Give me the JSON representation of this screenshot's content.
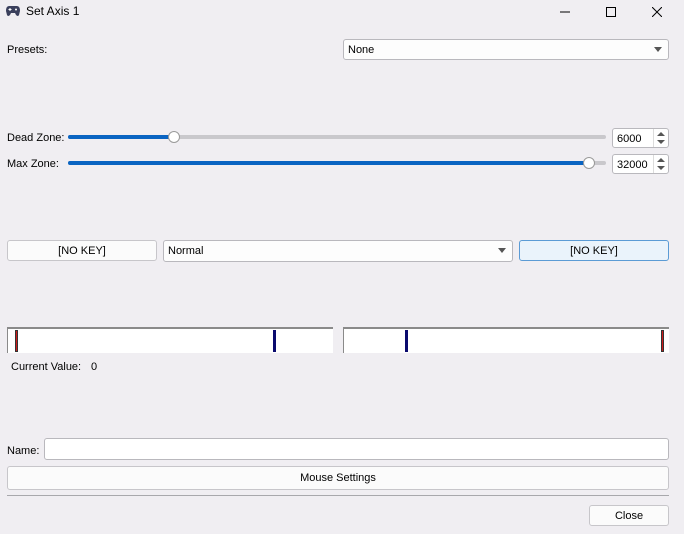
{
  "window": {
    "title": "Set Axis 1",
    "icon": "gamepad-icon"
  },
  "presets": {
    "label": "Presets:",
    "selected": "None"
  },
  "dead_zone": {
    "label": "Dead Zone:",
    "value": "6000",
    "slider_fraction": 0.19
  },
  "max_zone": {
    "label": "Max Zone:",
    "value": "32000",
    "slider_fraction": 0.98
  },
  "key_row": {
    "left_key": "[NO KEY]",
    "mode_selected": "Normal",
    "right_key": "[NO KEY]"
  },
  "current_value": {
    "label": "Current Value:",
    "value": "0"
  },
  "name": {
    "label": "Name:",
    "value": ""
  },
  "mouse_settings_label": "Mouse Settings",
  "close_label": "Close",
  "colors": {
    "accent": "#0a64c2",
    "marker_red": "#cc1a1a",
    "marker_blue": "#0a0a6e"
  }
}
